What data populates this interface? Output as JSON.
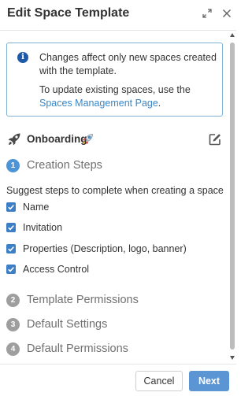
{
  "dialog": {
    "title": "Edit Space Template",
    "expand_icon": "expand-icon",
    "close_icon": "close-icon"
  },
  "info": {
    "icon": "info-icon",
    "line1": "Changes affect only new spaces created with the template.",
    "line2_prefix": "To update existing spaces, use the",
    "link_text": "Spaces Management Page",
    "line2_suffix": "."
  },
  "section": {
    "icon": "rocket-icon",
    "name": "Onboarding",
    "edit_icon": "edit-icon"
  },
  "steps": [
    {
      "number": "1",
      "label": "Creation Steps",
      "active": true
    },
    {
      "number": "2",
      "label": "Template Permissions",
      "active": false
    },
    {
      "number": "3",
      "label": "Default Settings",
      "active": false
    },
    {
      "number": "4",
      "label": "Default Permissions",
      "active": false
    }
  ],
  "creation": {
    "description": "Suggest steps to complete when creating a space",
    "options": [
      {
        "label": "Name",
        "checked": true
      },
      {
        "label": "Invitation",
        "checked": true
      },
      {
        "label": "Properties (Description, logo, banner)",
        "checked": true
      },
      {
        "label": "Access Control",
        "checked": true
      }
    ]
  },
  "footer": {
    "cancel_label": "Cancel",
    "next_label": "Next"
  },
  "colors": {
    "accent": "#4d94d6",
    "checkbox": "#3d7fc7",
    "link": "#3a87c8",
    "info_border": "#7fb3d5",
    "primary_button": "#5b95d4"
  }
}
